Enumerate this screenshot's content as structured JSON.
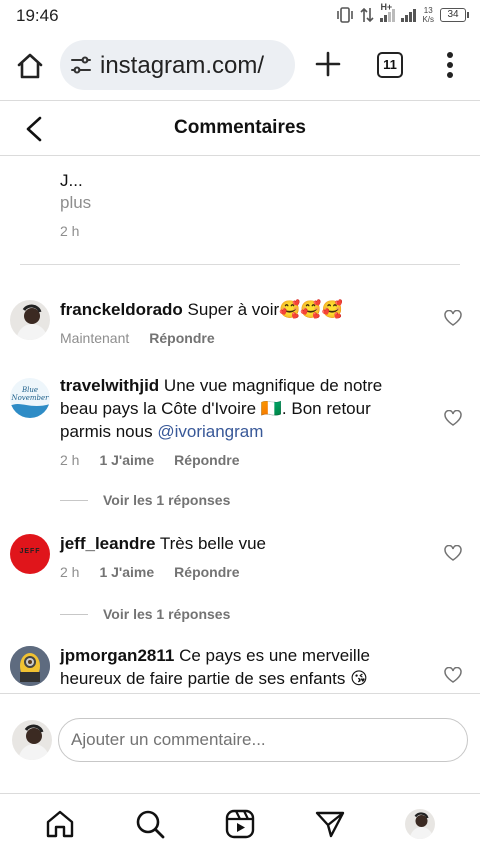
{
  "status_bar": {
    "time": "19:46",
    "network": "H+",
    "speed_value": "13",
    "speed_unit": "K/s",
    "battery": "34"
  },
  "browser": {
    "url": "instagram.com/",
    "tab_count": "11"
  },
  "header": {
    "title": "Commentaires"
  },
  "previous_comment": {
    "text": "J...",
    "more": "plus",
    "time": "2 h"
  },
  "comments": [
    {
      "username": "franckeldorado",
      "text": "Super à voir🥰🥰🥰",
      "time": "Maintenant",
      "likes": "",
      "reply": "Répondre",
      "replies": ""
    },
    {
      "username": "travelwithjid",
      "text": "Une vue magnifique de notre beau pays la Côte d'Ivoire 🇨🇮. Bon retour parmis nous ",
      "mention": "@ivoriangram",
      "time": "2 h",
      "likes": "1 J'aime",
      "reply": "Répondre",
      "replies": "Voir les 1 réponses",
      "avatar_text_1": "Blue",
      "avatar_text_2": "November"
    },
    {
      "username": "jeff_leandre",
      "text": "Très belle vue",
      "time": "2 h",
      "likes": "1 J'aime",
      "reply": "Répondre",
      "replies": "Voir les 1 réponses",
      "avatar_text": "JEFF"
    },
    {
      "username": "jpmorgan2811",
      "text": "Ce pays es une merveille heureux de faire partie de ses enfants 😘",
      "time": "",
      "likes": "",
      "reply": "",
      "replies": ""
    }
  ],
  "input": {
    "placeholder": "Ajouter un commentaire..."
  },
  "colors": {
    "link": "#385898",
    "muted": "#8e8e8e",
    "divider": "#dbdbdb",
    "jeff_avatar": "#e0151b"
  }
}
